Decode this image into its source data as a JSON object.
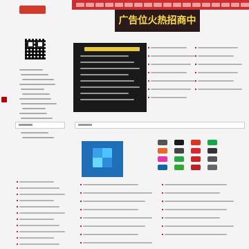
{
  "header": {
    "logo_label": "",
    "ad_banner_text": "广告位火热招商中",
    "nav_items": [
      "",
      "",
      "",
      "",
      "",
      "",
      "",
      "",
      "",
      "",
      "",
      "",
      "",
      "",
      "",
      "",
      "",
      ""
    ]
  },
  "left_panel": {
    "rows": [
      "",
      "",
      "",
      "",
      "",
      "",
      "",
      "",
      "",
      "",
      "",
      "",
      "",
      "",
      ""
    ]
  },
  "ad_panel": {
    "title": "",
    "rows": [
      "",
      "",
      "",
      "",
      "",
      "",
      "",
      ""
    ]
  },
  "list_top": {
    "rows": [
      "",
      "",
      "",
      "",
      "",
      "",
      "",
      "",
      "",
      "",
      "",
      "",
      ""
    ]
  },
  "section_tabs": [
    "",
    ""
  ],
  "list_bottom": {
    "rows": [
      "",
      "",
      "",
      "",
      "",
      "",
      "",
      "",
      "",
      "",
      "",
      "",
      "",
      "",
      ""
    ]
  },
  "left_bottom": {
    "rows": [
      "",
      "",
      "",
      "",
      "",
      "",
      "",
      "",
      "",
      "",
      "",
      ""
    ]
  },
  "colors": {
    "nav_bg": "#cf2e2e",
    "ad_panel_bg": "#1a1a1a",
    "accent_yellow": "#e8c73a"
  }
}
